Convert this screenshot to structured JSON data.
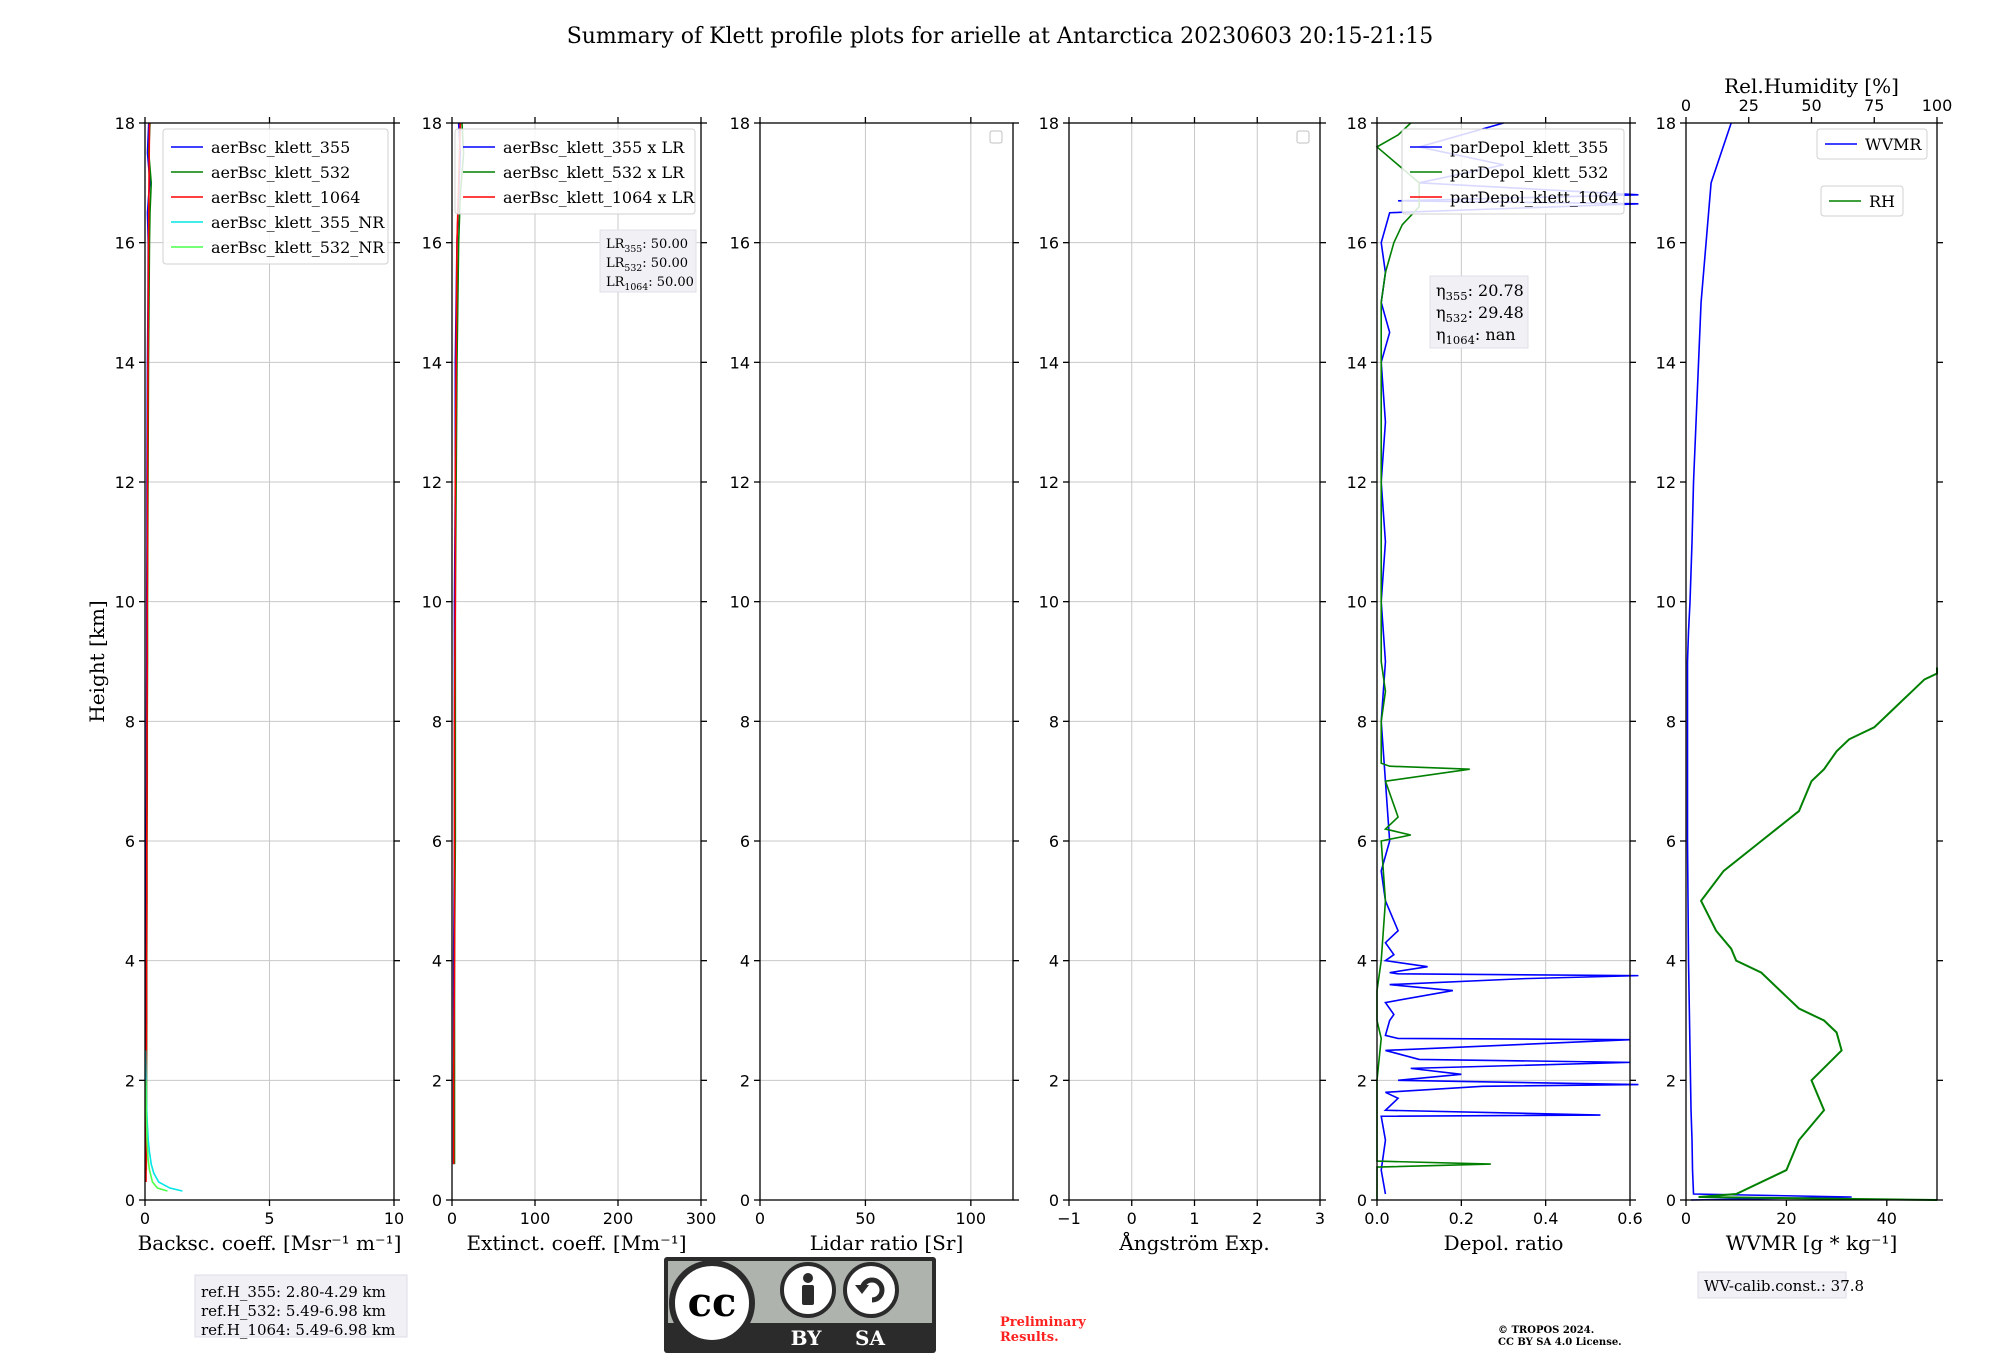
{
  "figure": {
    "title": "Summary of Klett profile plots for arielle at Antarctica 20230603 20:15-21:15"
  },
  "chart_data": [
    {
      "type": "line",
      "xlabel": "Backsc. coeff. [Msr⁻¹ m⁻¹]",
      "ylabel": "Height [km]",
      "xlim": [
        0,
        10
      ],
      "ylim": [
        0,
        18
      ],
      "xticks": [
        "0",
        "5",
        "10"
      ],
      "yticks": [
        "0",
        "2",
        "4",
        "6",
        "8",
        "10",
        "12",
        "14",
        "16",
        "18"
      ],
      "grid": true,
      "legend_position": "top-right",
      "series": [
        {
          "name": "aerBsc_klett_355",
          "color": "#0000ff",
          "y": [
            0.3,
            1,
            2,
            3,
            4,
            5,
            6,
            7,
            8,
            9,
            10,
            11,
            12,
            13,
            14,
            15,
            16,
            16.5,
            16.8,
            17,
            17.5,
            18
          ],
          "x": [
            0.02,
            0.03,
            0.03,
            0.04,
            0.04,
            0.05,
            0.05,
            0.06,
            0.06,
            0.07,
            0.07,
            0.08,
            0.08,
            0.09,
            0.1,
            0.12,
            0.13,
            0.1,
            0.15,
            0.2,
            0.1,
            0.15
          ]
        },
        {
          "name": "aerBsc_klett_532",
          "color": "#008000",
          "y": [
            0.5,
            1,
            2,
            3,
            4,
            5,
            6,
            7,
            8,
            9,
            10,
            11,
            12,
            13,
            14,
            15,
            16,
            16.5,
            17,
            17.5,
            18
          ],
          "x": [
            0.05,
            0.06,
            0.06,
            0.07,
            0.07,
            0.08,
            0.08,
            0.09,
            0.09,
            0.1,
            0.1,
            0.11,
            0.12,
            0.13,
            0.14,
            0.16,
            0.18,
            0.2,
            0.25,
            0.15,
            0.2
          ]
        },
        {
          "name": "aerBsc_klett_1064",
          "color": "#ff0000",
          "y": [
            0.3,
            1,
            2,
            3,
            4,
            5,
            6,
            7,
            8,
            9,
            10,
            11,
            12,
            13,
            14,
            15,
            16,
            17,
            18
          ],
          "x": [
            0.04,
            0.05,
            0.05,
            0.06,
            0.06,
            0.07,
            0.07,
            0.08,
            0.08,
            0.09,
            0.09,
            0.1,
            0.1,
            0.11,
            0.12,
            0.13,
            0.14,
            0.16,
            0.18
          ]
        },
        {
          "name": "aerBsc_klett_355_NR",
          "color": "#00e5e5",
          "y": [
            0.15,
            0.2,
            0.3,
            0.45,
            0.6,
            0.8,
            1.0,
            1.3,
            1.6,
            2.0,
            2.5
          ],
          "x": [
            1.5,
            1.0,
            0.55,
            0.35,
            0.25,
            0.18,
            0.13,
            0.09,
            0.06,
            0.04,
            0.02
          ]
        },
        {
          "name": "aerBsc_klett_532_NR",
          "color": "#4cff4c",
          "y": [
            0.15,
            0.2,
            0.3,
            0.5,
            0.7,
            1.0,
            1.5,
            2.0
          ],
          "x": [
            0.9,
            0.5,
            0.3,
            0.18,
            0.12,
            0.08,
            0.05,
            0.03
          ]
        }
      ],
      "annotation": [
        "ref.H_355: 2.80-4.29 km",
        "ref.H_532: 5.49-6.98 km",
        "ref.H_1064: 5.49-6.98 km"
      ]
    },
    {
      "type": "line",
      "xlabel": "Extinct. coeff. [Mm⁻¹]",
      "xlim": [
        0,
        300
      ],
      "ylim": [
        0,
        18
      ],
      "xticks": [
        "0",
        "100",
        "200",
        "300"
      ],
      "yticks": [
        "0",
        "2",
        "4",
        "6",
        "8",
        "10",
        "12",
        "14",
        "16",
        "18"
      ],
      "grid": true,
      "legend_position": "top-right",
      "series": [
        {
          "name": "aerBsc_klett_355 x LR",
          "color": "#0000ff",
          "y": [
            0.6,
            2,
            4,
            6,
            8,
            10,
            12,
            14,
            15,
            16,
            16.8,
            17.5,
            18
          ],
          "x": [
            2,
            2,
            2,
            3,
            3,
            3,
            4,
            4,
            5,
            6,
            8,
            10,
            8
          ]
        },
        {
          "name": "aerBsc_klett_532 x LR",
          "color": "#008000",
          "y": [
            0.6,
            2,
            4,
            6,
            8,
            10,
            12,
            14,
            15,
            16,
            16.8,
            17.5,
            18
          ],
          "x": [
            3,
            3,
            3,
            4,
            4,
            4,
            5,
            6,
            7,
            8,
            10,
            14,
            12
          ]
        },
        {
          "name": "aerBsc_klett_1064 x LR",
          "color": "#ff0000",
          "y": [
            0.6,
            2,
            4,
            6,
            8,
            10,
            12,
            14,
            16,
            17,
            18
          ],
          "x": [
            2,
            2,
            3,
            3,
            3,
            4,
            4,
            5,
            6,
            8,
            10
          ]
        }
      ],
      "lidar_ratio_box": [
        {
          "label": "LR",
          "sub": "355",
          "value": ": 50.00"
        },
        {
          "label": "LR",
          "sub": "532",
          "value": ": 50.00"
        },
        {
          "label": "LR",
          "sub": "1064",
          "value": ": 50.00"
        }
      ]
    },
    {
      "type": "line",
      "xlabel": "Lidar ratio [Sr]",
      "xlim": [
        0,
        120
      ],
      "ylim": [
        0,
        18
      ],
      "xticks": [
        "0",
        "50",
        "100"
      ],
      "yticks": [
        "0",
        "2",
        "4",
        "6",
        "8",
        "10",
        "12",
        "14",
        "16",
        "18"
      ],
      "grid": true,
      "series": []
    },
    {
      "type": "line",
      "xlabel": "Ångström Exp.",
      "xlim": [
        -1,
        3
      ],
      "ylim": [
        0,
        18
      ],
      "xticks": [
        "−1",
        "0",
        "1",
        "2",
        "3"
      ],
      "yticks": [
        "0",
        "2",
        "4",
        "6",
        "8",
        "10",
        "12",
        "14",
        "16",
        "18"
      ],
      "grid": true,
      "series": []
    },
    {
      "type": "line",
      "xlabel": "Depol. ratio",
      "xlim": [
        0,
        0.6
      ],
      "ylim": [
        0,
        18
      ],
      "xticks": [
        "0.0",
        "0.2",
        "0.4",
        "0.6"
      ],
      "yticks": [
        "0",
        "2",
        "4",
        "6",
        "8",
        "10",
        "12",
        "14",
        "16",
        "18"
      ],
      "grid": true,
      "legend_position": "top-right",
      "series": [
        {
          "name": "parDepol_klett_355",
          "color": "#0000ff",
          "y": [
            0.1,
            0.5,
            1.0,
            1.4,
            1.42,
            1.5,
            1.7,
            1.8,
            1.9,
            1.93,
            2.0,
            2.1,
            2.2,
            2.3,
            2.35,
            2.5,
            2.68,
            2.7,
            2.75,
            3.0,
            3.1,
            3.3,
            3.5,
            3.6,
            3.7,
            3.75,
            3.78,
            3.8,
            3.9,
            4.0,
            4.1,
            4.3,
            4.5,
            5.0,
            5.5,
            6.0,
            7.0,
            8.0,
            9.0,
            10.0,
            11.0,
            12.0,
            13.0,
            14.0,
            14.5,
            15.0,
            15.5,
            16.0,
            16.5,
            16.65,
            16.7,
            16.8,
            17.0,
            17.3,
            17.6,
            17.9,
            18.0
          ],
          "x": [
            0.02,
            0.01,
            0.02,
            0.01,
            0.53,
            0.02,
            0.05,
            0.02,
            0.25,
            0.62,
            0.05,
            0.2,
            0.08,
            0.6,
            0.1,
            0.02,
            0.6,
            0.05,
            0.02,
            0.03,
            0.04,
            0.02,
            0.18,
            0.03,
            0.35,
            0.62,
            0.05,
            0.03,
            0.12,
            0.02,
            0.04,
            0.02,
            0.05,
            0.02,
            0.01,
            0.03,
            0.02,
            0.01,
            0.02,
            0.01,
            0.02,
            0.01,
            0.02,
            0.01,
            0.03,
            0.01,
            0.02,
            0.01,
            0.03,
            0.62,
            0.05,
            0.62,
            0.1,
            0.3,
            0.1,
            0.25,
            0.3
          ]
        },
        {
          "name": "parDepol_klett_532",
          "color": "#008000",
          "y": [
            0.0,
            0.55,
            0.6,
            0.65,
            1.0,
            2.0,
            2.7,
            3.0,
            3.5,
            4.0,
            5.0,
            6.0,
            6.1,
            6.2,
            6.4,
            7.0,
            7.2,
            7.25,
            7.3,
            7.5,
            8.0,
            8.5,
            9.0,
            10.0,
            11.0,
            12.0,
            13.0,
            14.0,
            15.0,
            15.5,
            16.0,
            16.3,
            16.6,
            17.0,
            17.3,
            17.6,
            17.8,
            18.0
          ],
          "x": [
            0.0,
            0.0,
            0.27,
            0.0,
            0.0,
            0.0,
            0.01,
            0.0,
            0.0,
            0.01,
            0.02,
            0.01,
            0.08,
            0.02,
            0.05,
            0.02,
            0.22,
            0.03,
            0.01,
            0.01,
            0.01,
            0.02,
            0.01,
            0.01,
            0.01,
            0.01,
            0.01,
            0.01,
            0.01,
            0.02,
            0.04,
            0.06,
            0.1,
            0.1,
            0.05,
            0.0,
            0.05,
            0.08
          ]
        },
        {
          "name": "parDepol_klett_1064",
          "color": "#ff0000",
          "y": [],
          "x": []
        }
      ],
      "eta_box": [
        {
          "label": "η",
          "sub": "355",
          "value": ": 20.78"
        },
        {
          "label": "η",
          "sub": "532",
          "value": ": 29.48"
        },
        {
          "label": "η",
          "sub": "1064",
          "value": ": nan"
        }
      ]
    },
    {
      "type": "line",
      "xlabel": "WVMR [g * kg⁻¹]",
      "top_xlabel": "Rel.Humidity [%]",
      "xlim": [
        0,
        50
      ],
      "top_xlim": [
        0,
        100
      ],
      "ylim": [
        0,
        18
      ],
      "xticks": [
        "0",
        "20",
        "40"
      ],
      "top_xticks": [
        "0",
        "25",
        "50",
        "75",
        "100"
      ],
      "yticks": [
        "0",
        "2",
        "4",
        "6",
        "8",
        "10",
        "12",
        "14",
        "16",
        "18"
      ],
      "grid": false,
      "legend_position": "top-right",
      "series": [
        {
          "name": "WVMR",
          "color": "#0000ff",
          "y": [
            0,
            0.05,
            0.1,
            0.5,
            1.0,
            1.5,
            2.0,
            3.0,
            4.0,
            5.0,
            6.0,
            7.0,
            8.0,
            9.0,
            9.5,
            10,
            11,
            12,
            13,
            14,
            15,
            16,
            17,
            17.5,
            18
          ],
          "x": [
            1,
            33,
            1.5,
            1.3,
            1.2,
            1.0,
            0.9,
            0.7,
            0.5,
            0.4,
            0.3,
            0.3,
            0.3,
            0.3,
            0.5,
            0.8,
            1.2,
            1.5,
            2,
            2.5,
            3,
            4,
            5,
            7,
            9
          ]
        },
        {
          "name": "RH",
          "color": "#008000",
          "x_top": [
            100,
            5,
            20,
            40,
            45,
            55,
            50,
            62,
            60,
            55,
            45,
            40,
            35,
            30,
            20,
            18,
            12,
            6,
            15,
            30,
            45,
            50,
            55,
            60,
            65,
            75,
            80,
            85,
            90,
            95,
            100,
            100
          ],
          "y": [
            0,
            0.05,
            0.1,
            0.5,
            1.0,
            1.5,
            2.0,
            2.5,
            2.8,
            3.0,
            3.2,
            3.4,
            3.6,
            3.8,
            4.0,
            4.2,
            4.5,
            5.0,
            5.5,
            6.0,
            6.5,
            7.0,
            7.2,
            7.5,
            7.7,
            7.9,
            8.1,
            8.3,
            8.5,
            8.7,
            8.8,
            8.9
          ]
        }
      ],
      "annotation": "WV-calib.const.: 37.8"
    }
  ],
  "footer": {
    "preliminary_line1": "Preliminary",
    "preliminary_line2": "Results.",
    "copyright_line1": "© TROPOS 2024.",
    "copyright_line2": "CC BY SA 4.0 License.",
    "cc_logo": {
      "text": "cc",
      "by": "BY",
      "sa": "SA"
    }
  }
}
